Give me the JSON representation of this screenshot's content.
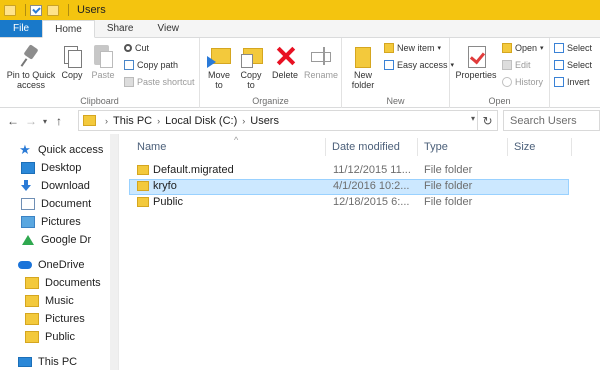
{
  "window": {
    "title": "Users"
  },
  "tabs": [
    {
      "label": "File"
    },
    {
      "label": "Home"
    },
    {
      "label": "Share"
    },
    {
      "label": "View"
    }
  ],
  "ribbon": {
    "clipboard": {
      "label": "Clipboard",
      "pin": "Pin to Quick access",
      "copy": "Copy",
      "paste": "Paste",
      "cut": "Cut",
      "copy_path": "Copy path",
      "paste_shortcut": "Paste shortcut"
    },
    "organize": {
      "label": "Organize",
      "move_to": "Move to",
      "copy_to": "Copy to",
      "delete": "Delete",
      "rename": "Rename"
    },
    "new": {
      "label": "New",
      "new_folder": "New folder",
      "new_item": "New item",
      "easy_access": "Easy access"
    },
    "open": {
      "label": "Open",
      "properties": "Properties",
      "open": "Open",
      "edit": "Edit",
      "history": "History"
    },
    "select": {
      "select_all": "Select",
      "select_none": "Select",
      "invert": "Invert"
    }
  },
  "address": {
    "crumbs": [
      "This PC",
      "Local Disk (C:)",
      "Users"
    ],
    "search_placeholder": "Search Users"
  },
  "nav": {
    "quick_access": "Quick access",
    "items": [
      {
        "label": "Desktop"
      },
      {
        "label": "Download"
      },
      {
        "label": "Document"
      },
      {
        "label": "Pictures"
      },
      {
        "label": "Google Dr"
      }
    ],
    "onedrive": "OneDrive",
    "onedrive_items": [
      {
        "label": "Documents"
      },
      {
        "label": "Music"
      },
      {
        "label": "Pictures"
      },
      {
        "label": "Public"
      }
    ],
    "this_pc": "This PC"
  },
  "files": {
    "columns": {
      "name": "Name",
      "date": "Date modified",
      "type": "Type",
      "size": "Size"
    },
    "rows": [
      {
        "name": "Default.migrated",
        "date": "11/12/2015 11...",
        "type": "File folder"
      },
      {
        "name": "kryfo",
        "date": "4/1/2016 10:2...",
        "type": "File folder"
      },
      {
        "name": "Public",
        "date": "12/18/2015 6:...",
        "type": "File folder"
      }
    ]
  },
  "colors": {
    "titlebar": "#f4c40f",
    "file_tab": "#1979ca",
    "selection": "#cce8ff"
  }
}
